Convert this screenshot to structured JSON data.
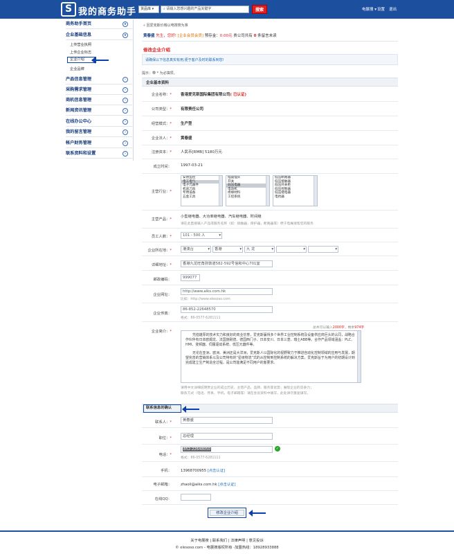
{
  "header": {
    "logo_mark": "S",
    "logo_text": "我的商务助手",
    "search_select": "货品库 ▾",
    "search_placeholder": "请输入您感兴趣的产品关键字",
    "search_button": "搜索",
    "nav": [
      "电展搜 ▾",
      "设置",
      "退出"
    ]
  },
  "sidebar": {
    "sections": [
      {
        "label": "商务助手首页",
        "icon": "∨"
      },
      {
        "label": "企业基础信息",
        "icon": "∨",
        "items": [
          "上传营业执照",
          "上传企业标志",
          "企业介绍",
          "企业品牌"
        ],
        "current": "企业介绍"
      },
      {
        "label": "产品信息管理",
        "icon": "›"
      },
      {
        "label": "采购需求管理",
        "icon": "›"
      },
      {
        "label": "商机信息管理",
        "icon": "›"
      },
      {
        "label": "新闻资讯管理",
        "icon": "›"
      },
      {
        "label": "在线办公中心",
        "icon": "›"
      },
      {
        "label": "我的留言管理",
        "icon": "›"
      },
      {
        "label": "帐户财务管理",
        "icon": "›"
      },
      {
        "label": "联系资料和设置",
        "icon": "›"
      }
    ]
  },
  "main": {
    "back_link": "« 回爱克斯价格以电搜搜为准",
    "greeting": {
      "name": "黄春盛",
      "suffix": "先生，您好!",
      "member": "[企业会员会员]",
      "deposit_label": "预存金：",
      "deposit": "0.00元",
      "msg_prefix": "贵公司共有",
      "msg_count": "0",
      "msg_suffix": "条留言未读"
    },
    "page_title": "修改企业介绍",
    "notice": "请确保以下信息真实有用,便于客户及时的联系到您!",
    "required_hint": "提示：带 * 为必填项。",
    "section1_title": "企业基本资料",
    "fields": {
      "company_name_label": "企业名称：",
      "company_name": "香港爱克斯国际集团有限公司",
      "company_verified": "( 已认证)",
      "company_type_label": "公司类型：",
      "company_type": "有限责任公司",
      "business_model_label": "经营模式：",
      "business_model": "生产型",
      "legal_rep_label": "企业法人：",
      "legal_rep": "黄春盛",
      "capital_label": "注册资本：",
      "capital": "人民币[RMB] 5180万元",
      "founded_label": "成立时间：",
      "founded": "1997-03-21",
      "industry_label": "主营行业：",
      "industry_col1": [
        "安防监控",
        "电工电气",
        "电子元器件",
        "机床刀具",
        "专用设备",
        "五金工具"
      ],
      "industry_col1_sel": "电工电气",
      "industry_col2": [
        "插座插头",
        "开关",
        "低压电器",
        "电动机",
        "绝缘材料",
        "工控系统"
      ],
      "industry_col2_sel": "低压电器",
      "industry_col3": [
        "低压断路器",
        "低压接触器",
        "低压开关柜",
        "低压控制器",
        "低压继电器",
        "电抗器"
      ],
      "products_label": "主营产品：",
      "products": "小型继电器、大功率继电器、汽车继电器、时间继",
      "products_hint": "请在此直接输入产品或服务名称（如：接触器，保护器，断路器等）便于电展搜帮您的服务",
      "staff_label": "员工人数：",
      "staff": "101 - 500 人",
      "location_label": "企业所在地：",
      "loc_country": "港澳台",
      "loc_region": "香港",
      "loc_city": "九 龙",
      "address_label": "详细地址：",
      "address": "香港九龙旺角弥敦道582-592号信和中心701室",
      "zip_label": "邮政编码：",
      "zip": "999077",
      "website_label": "企业网址：",
      "website": "http://www.aiks.com.hk",
      "website_hint": "比如：http://www.elesoso.com",
      "fax_label": "企业传真：",
      "fax": "86-852-22648570",
      "fax_hint": "格式：86-0577-6281111",
      "intro_label": "企业简介：",
      "intro_counter_prefix": "总共可以输入",
      "intro_counter_total": "2000字",
      "intro_counter_mid": "，剩余",
      "intro_counter_left": "974字",
      "intro_p1": "凭借雄厚的技术实力和良好的商业信誉，爱克斯赢得多个世界工业控制系统及设备供应商巨头的认同，战略合作伙伴有日本欧姆龙、法国施耐德、德国西门子、日本安川、日本三菱、瑞士ABB等。合作产品领域涵盖：PLC、HMI、变频器、伺服驱动系统、低压元器件等。",
      "intro_p2": "无论在亚洲、欧洲、美洲还是大洋洲，爱克斯人以国际化的视野致力于推进自动化控制领域的应用与发展，期望完善的营销体系以及公司特有的“星级物流”式的从控制到控制系统的解决方案，爱克斯旨于为用户的初期设计到完成建立生产制造全过程，是公司能满足不同用户的客要求。",
      "intro_hint1": "请用中文详细说明贵企业的成立历史、主营产品、品牌、服务等优势；展现企业的竞争力；",
      "intro_hint2": "联系方式（电话、传真、手机、电子邮箱等）请在会员资料中填写，此处请勿重复填写。"
    },
    "section2_title": "联系信息的确认",
    "contact": {
      "person_label": "联系人：",
      "person": "黄春盛",
      "position_label": "职位：",
      "position": "总经理",
      "phone_label": "电话：",
      "phone": "852-22648050",
      "phone_hint": "格式：86-0577-6281111",
      "mobile_label": "手机：",
      "mobile": "13968700955",
      "mobile_verify": "[点击认证]",
      "email_label": "电子邮箱：",
      "email": "zhaoli@aiks.com.hk",
      "email_verify": "[点击认证]",
      "qq_label": "在线QQ：",
      "qq": ""
    },
    "submit": "修改企业介绍"
  },
  "footer": {
    "links": "关于电展搜 | 联系我们 | 法律声明 | 意见投诉",
    "copyright": "© elesoso.com - 电展搜版权所有 -加盟热线：18928933888"
  },
  "colors": {
    "brand": "#1d4f9f",
    "accent_red": "#e02020",
    "annotation_blue": "#0a3fb0"
  }
}
